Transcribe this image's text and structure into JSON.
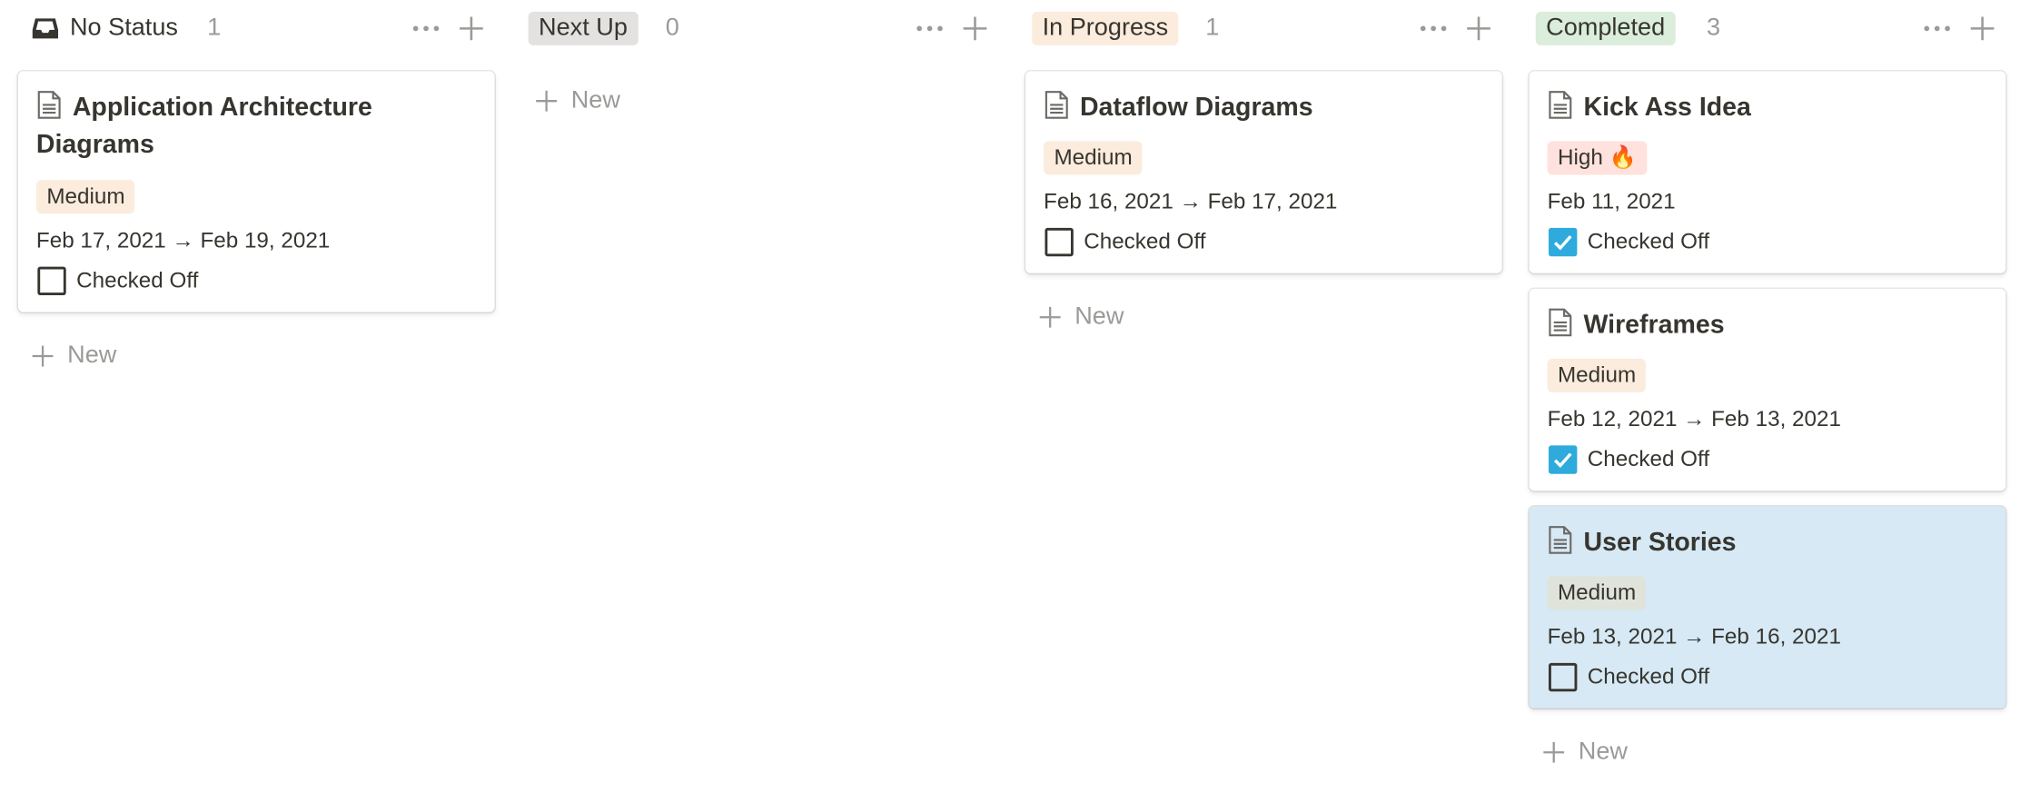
{
  "columns": [
    {
      "title": "No Status",
      "count": "1",
      "icon": "inbox-icon",
      "pill_color": "",
      "new_label": "New",
      "cards": [
        {
          "title": "Application Architecture Diagrams",
          "priority": "Medium",
          "priority_color": "#fbecdd",
          "dates": "Feb 17, 2021 → Feb 19, 2021",
          "check_label": "Checked Off",
          "checked": false,
          "selected": false
        }
      ]
    },
    {
      "title": "Next Up",
      "count": "0",
      "pill_color": "#e3e2e0",
      "new_label": "New",
      "cards": []
    },
    {
      "title": "In Progress",
      "count": "1",
      "pill_color": "#fbecdd",
      "new_label": "New",
      "cards": [
        {
          "title": "Dataflow Diagrams",
          "priority": "Medium",
          "priority_color": "#fbecdd",
          "dates": "Feb 16, 2021 → Feb 17, 2021",
          "check_label": "Checked Off",
          "checked": false,
          "selected": false
        }
      ]
    },
    {
      "title": "Completed",
      "count": "3",
      "pill_color": "#dbeddb",
      "new_label": "New",
      "cards": [
        {
          "title": "Kick Ass Idea",
          "priority": "High 🔥",
          "priority_color": "#ffe2dd",
          "dates": "Feb 11, 2021",
          "check_label": "Checked Off",
          "checked": true,
          "selected": false
        },
        {
          "title": "Wireframes",
          "priority": "Medium",
          "priority_color": "#fbecdd",
          "dates": "Feb 12, 2021 → Feb 13, 2021",
          "check_label": "Checked Off",
          "checked": true,
          "selected": false
        },
        {
          "title": "User Stories",
          "priority": "Medium",
          "priority_color": "#e0e3d9",
          "dates": "Feb 13, 2021 → Feb 16, 2021",
          "check_label": "Checked Off",
          "checked": false,
          "selected": true
        }
      ]
    }
  ],
  "colors": {
    "checkbox_checked": "#2eaadc",
    "selected_card": "#d6e9f5"
  }
}
